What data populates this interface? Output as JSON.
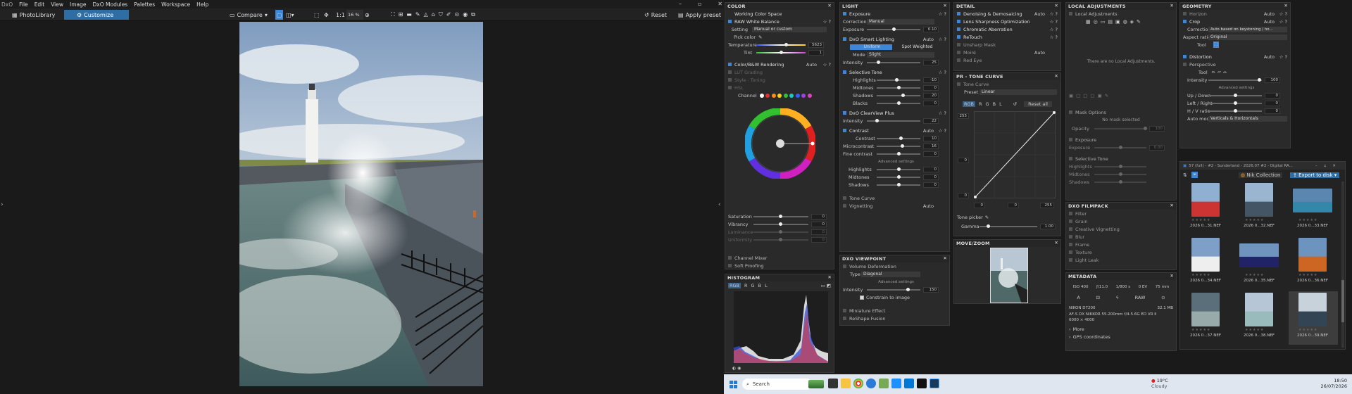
{
  "menu": {
    "logo": "DxO",
    "items": [
      "File",
      "Edit",
      "View",
      "Image",
      "DxO Modules",
      "Palettes",
      "Workspace",
      "Help"
    ]
  },
  "toolbar": {
    "photolibrary": "PhotoLibrary",
    "customize": "Customize",
    "compare": "Compare",
    "zoom": "16 %",
    "reset": "Reset",
    "apply_preset": "Apply preset",
    "ratio": "1:1"
  },
  "color": {
    "title": "COLOR",
    "working": "Working Color Space",
    "wb": "RAW White Balance",
    "setting_label": "Setting",
    "setting_value": "Manual or custom",
    "pick": "Pick color",
    "temp_label": "Temperature",
    "temp": "5623",
    "tint_label": "Tint",
    "tint": "1",
    "cbw": "Color/B&W Rendering",
    "cbw_auto": "Auto",
    "lut": "LUT Grading",
    "style": "Style - Toning",
    "hsl": "HSL",
    "channel": "Channel",
    "sat_label": "Saturation",
    "sat": "0",
    "vib_label": "Vibrancy",
    "vib": "0",
    "lum_label": "Luminance",
    "lum": "0",
    "uni_label": "Uniformity",
    "uni": "0",
    "mixer": "Channel Mixer",
    "soft": "Soft Proofing",
    "hsl_colors": [
      "#ffffff",
      "#e03030",
      "#ff8c1a",
      "#ffd21a",
      "#30c030",
      "#1ac8c8",
      "#3060ff",
      "#a040e0",
      "#e040c0"
    ]
  },
  "histogram": {
    "title": "HISTOGRAM",
    "channels": [
      "RGB",
      "R",
      "G",
      "B",
      "L"
    ]
  },
  "light": {
    "title": "LIGHT",
    "exposure": "Exposure",
    "corr_label": "Correction",
    "corr": "Manual",
    "exp_label": "Exposure",
    "exp": "0.10",
    "smart": "DxO Smart Lighting",
    "smart_auto": "Auto",
    "uniform": "Uniform",
    "spot": "Spot Weighted",
    "mode_label": "Mode",
    "mode": "Slight",
    "int_label": "Intensity",
    "int": "25",
    "seltone": "Selective Tone",
    "hl_label": "Highlights",
    "hl": "-10",
    "mid_label": "Midtones",
    "mid": "0",
    "sh_label": "Shadows",
    "sh": "20",
    "bl_label": "Blacks",
    "bl": "0",
    "clear": "DxO ClearView Plus",
    "clear_int_label": "Intensity",
    "clear_int": "22",
    "contrast": "Contrast",
    "contrast_auto": "Auto",
    "c_label": "Contrast",
    "c": "10",
    "micro_label": "Microcontrast",
    "micro": "16",
    "fine_label": "Fine contrast",
    "fine": "0",
    "adv": "Advanced settings",
    "ahl_label": "Highlights",
    "ahl": "0",
    "amid_label": "Midtones",
    "amid": "0",
    "ash_label": "Shadows",
    "ash": "0",
    "tonecurve": "Tone Curve",
    "vignetting": "Vignetting",
    "vig_auto": "Auto"
  },
  "viewpoint": {
    "title": "DXO VIEWPOINT",
    "vol": "Volume Deformation",
    "type_label": "Type",
    "type": "Diagonal",
    "adv": "Advanced settings",
    "int_label": "Intensity",
    "int": "150",
    "constrain": "Constrain to image",
    "miniature": "Miniature Effect",
    "reshape": "ReShape Fusion"
  },
  "detail": {
    "title": "DETAIL",
    "denoise": "Denoising & Demosaicing",
    "denoise_auto": "Auto",
    "lens": "Lens Sharpness Optimization",
    "chrom": "Chromatic Aberration",
    "retouch": "ReTouch",
    "unsharp": "Unsharp Mask",
    "moire": "Moiré",
    "moire_auto": "Auto",
    "redeye": "Red Eye"
  },
  "curve": {
    "title": "PR - TONE CURVE",
    "sub": "Tone Curve",
    "preset_label": "Preset",
    "preset": "Linear",
    "channels": [
      "RGB",
      "R",
      "G",
      "B",
      "L"
    ],
    "resetall": "Reset all",
    "v255": "255",
    "v0": "0",
    "v0b": "0",
    "b0": "0",
    "b0b": "0",
    "b255": "255",
    "picker": "Tone picker",
    "gamma_label": "Gamma",
    "gamma": "1.00"
  },
  "movezoom": {
    "title": "MOVE/ZOOM"
  },
  "local": {
    "title": "LOCAL ADJUSTMENTS",
    "sub": "Local Adjustments",
    "none": "There are no Local Adjustments.",
    "mask": "Mask Options",
    "nomask": "No mask selected",
    "opacity": "Opacity",
    "opacity_v": "100",
    "exposure": "Exposure",
    "exp_label": "Exposure",
    "exp_v": "0.00",
    "seltone": "Selective Tone",
    "hl": "Highlights",
    "mid": "Midtones",
    "sh": "Shadows"
  },
  "filmpack": {
    "title": "DXO FILMPACK",
    "items": [
      "Filter",
      "Grain",
      "Creative Vignetting",
      "Blur",
      "Frame",
      "Texture",
      "Light Leak"
    ]
  },
  "metadata": {
    "title": "METADATA",
    "iso": "ISO 400",
    "f": "ƒ/11.0",
    "shutter": "1/800 s",
    "ev": "0 EV",
    "focal": "75 mm",
    "a": "A",
    "raw": "RAW",
    "camera": "NIKON D7200",
    "size": "32.1 MB",
    "lens": "AF-S DX NIKKOR 55-200mm f/4-5.6G ED VR II",
    "dims": "6000 × 4000",
    "more": "More",
    "gps": "GPS coordinates"
  },
  "geometry": {
    "title": "GEOMETRY",
    "horizon": "Horizon",
    "horizon_auto": "Auto",
    "crop": "Crop",
    "crop_auto": "Auto",
    "corr_label": "Correction",
    "corr": "Auto based on keystoning / ho...",
    "aspect_label": "Aspect ratio",
    "aspect": "Original",
    "tool": "Tool",
    "distortion": "Distortion",
    "dist_auto": "Auto",
    "perspective": "Perspective",
    "tool2": "Tool",
    "int_label": "Intensity",
    "int": "100",
    "adv": "Advanced settings",
    "ud_label": "Up / Down",
    "ud": "0",
    "lr_label": "Left / Right",
    "lr": "0",
    "hv_label": "H / V ratio",
    "hv": "0",
    "auto_label": "Auto mode",
    "auto": "Verticals & Horizontals"
  },
  "browser": {
    "title": "57 (full) - #2 - Sunderland - 2026.07 #2 - Digital RA...",
    "nik": "Nik Collection",
    "export": "Export to disk",
    "thumbs": [
      "2026 0...31.NEF",
      "2026 0...32.NEF",
      "2026 0...33.NEF",
      "2026 0...34.NEF",
      "2026 0...35.NEF",
      "2026 0...36.NEF",
      "2026 0...37.NEF",
      "2026 0...38.NEF",
      "2026 0...39.NEF"
    ]
  },
  "taskbar": {
    "search": "Search",
    "temp": "19°C",
    "weather": "Cloudy",
    "time": "18:50",
    "date": "26/07/2026"
  }
}
